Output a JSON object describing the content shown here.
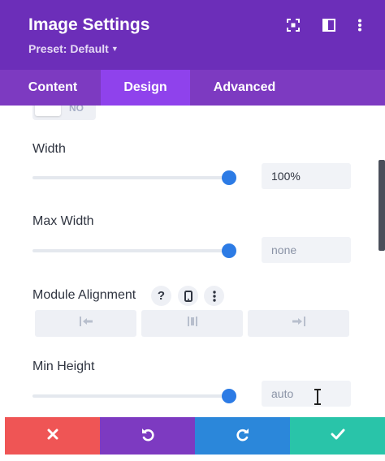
{
  "header": {
    "title": "Image Settings",
    "preset": "Preset: Default",
    "icons": [
      "focus-icon",
      "split-view-icon",
      "more-options-icon"
    ]
  },
  "tabs": [
    {
      "label": "Content",
      "active": false
    },
    {
      "label": "Design",
      "active": true
    },
    {
      "label": "Advanced",
      "active": false
    }
  ],
  "toggle": {
    "label": "NO"
  },
  "width": {
    "label": "Width",
    "value": "100%",
    "slider_fraction": 1.0
  },
  "max_width": {
    "label": "Max Width",
    "placeholder": "none",
    "slider_fraction": 1.0
  },
  "module_alignment": {
    "label": "Module Alignment",
    "help_icon": "?",
    "options": [
      "align-left-icon",
      "align-center-icon",
      "align-right-icon"
    ]
  },
  "min_height": {
    "label": "Min Height",
    "placeholder": "auto",
    "slider_fraction": 1.0
  },
  "footer": {
    "buttons": [
      {
        "name": "discard-button",
        "icon": "close-icon",
        "color": "#ef5555"
      },
      {
        "name": "undo-button",
        "icon": "undo-icon",
        "color": "#7d3ac1"
      },
      {
        "name": "redo-button",
        "icon": "redo-icon",
        "color": "#2b87da"
      },
      {
        "name": "save-button",
        "icon": "check-icon",
        "color": "#29c4a9"
      }
    ]
  },
  "colors": {
    "header": "#6c2eb9",
    "tabs": "#7d3ac1",
    "active_tab": "#8f42ec",
    "slider": "#2c7be5"
  }
}
